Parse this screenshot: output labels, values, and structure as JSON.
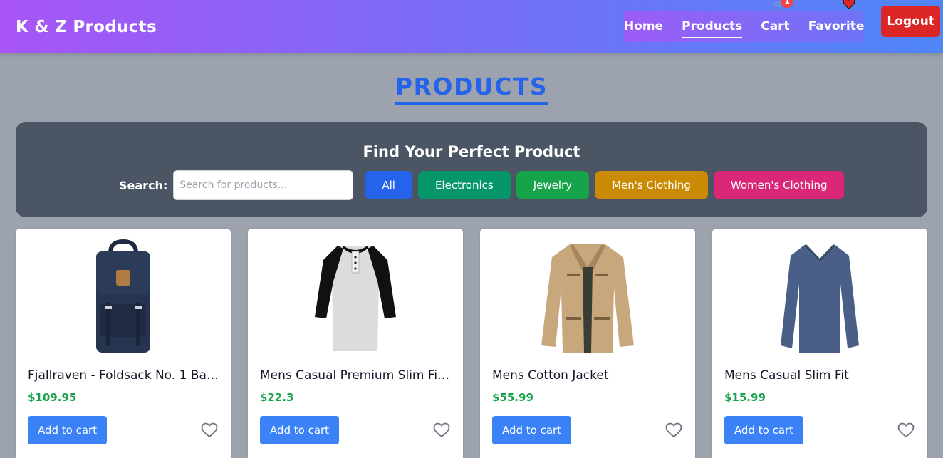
{
  "navbar": {
    "brand": "K & Z Products",
    "links": [
      {
        "label": "Home"
      },
      {
        "label": "Products",
        "active": true
      },
      {
        "label": "Cart"
      },
      {
        "label": "Favorite"
      }
    ],
    "cart_count": "1",
    "logout_label": "Logout"
  },
  "page": {
    "title": "PRODUCTS"
  },
  "filters": {
    "heading": "Find Your Perfect Product",
    "search_label": "Search:",
    "search_placeholder": "Search for products...",
    "search_value": "",
    "categories": [
      {
        "label": "All",
        "color": "#2563eb"
      },
      {
        "label": "Electronics",
        "color": "#059669"
      },
      {
        "label": "Jewelry",
        "color": "#16a34a"
      },
      {
        "label": "Men's Clothing",
        "color": "#ca8a04"
      },
      {
        "label": "Women's Clothing",
        "color": "#db2777"
      }
    ]
  },
  "products": [
    {
      "title": "Fjallraven - Foldsack No. 1 Bac...",
      "price": "$109.95",
      "image": "backpack-image",
      "add_label": "Add to cart"
    },
    {
      "title": "Mens Casual Premium Slim Fit ...",
      "price": "$22.3",
      "image": "raglan-tshirt-image",
      "add_label": "Add to cart"
    },
    {
      "title": "Mens Cotton Jacket",
      "price": "$55.99",
      "image": "cotton-jacket-image",
      "add_label": "Add to cart"
    },
    {
      "title": "Mens Casual Slim Fit",
      "price": "$15.99",
      "image": "longsleeve-shirt-image",
      "add_label": "Add to cart"
    }
  ],
  "colors": {
    "accent": "#2563eb",
    "price": "#16a34a",
    "logout": "#dc2626",
    "add_button": "#3b82f6",
    "panel": "#4b5563",
    "background": "#9ca3af"
  }
}
